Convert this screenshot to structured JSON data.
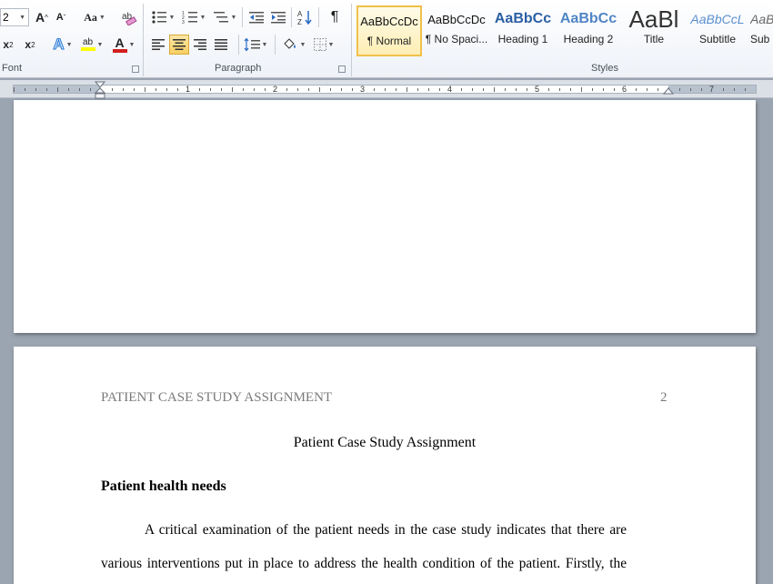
{
  "ribbon": {
    "font_size": "2",
    "groups": {
      "font": "Font",
      "paragraph": "Paragraph",
      "styles": "Styles"
    },
    "buttons": {
      "grow_font": "A",
      "shrink_font": "A",
      "change_case": "Aa",
      "subscript": "x",
      "superscript": "x",
      "sub_mark": "2",
      "sup_mark": "2",
      "text_effects": "A",
      "highlight": "ab",
      "font_color": "A",
      "show_marks": "¶"
    },
    "colors": {
      "highlight": "#ffff00",
      "font_color": "#d21f1f",
      "selected_style_border": "#f0c14a"
    },
    "styles": [
      {
        "sample": "AaBbCcDc",
        "name": "¶ Normal",
        "selected": true
      },
      {
        "sample": "AaBbCcDc",
        "name": "¶ No Spaci..."
      },
      {
        "sample": "AaBbCc",
        "name": "Heading 1"
      },
      {
        "sample": "AaBbCc",
        "name": "Heading 2"
      },
      {
        "sample": "AaBl",
        "name": "Title"
      },
      {
        "sample": "AaBbCcL",
        "name": "Subtitle"
      },
      {
        "sample": "AaB",
        "name": "Sub"
      }
    ]
  },
  "ruler": {
    "numbers": [
      "1",
      "2",
      "3",
      "4",
      "5",
      "6",
      "7"
    ]
  },
  "document": {
    "header_text": "PATIENT CASE STUDY ASSIGNMENT",
    "page_number": "2",
    "title": "Patient Case Study Assignment",
    "section_heading": "Patient health needs",
    "paragraph_line1": "A critical examination of the patient needs in the case study indicates that there are",
    "paragraph_line2": "various interventions put in place to address the health condition of the patient. Firstly, the"
  }
}
